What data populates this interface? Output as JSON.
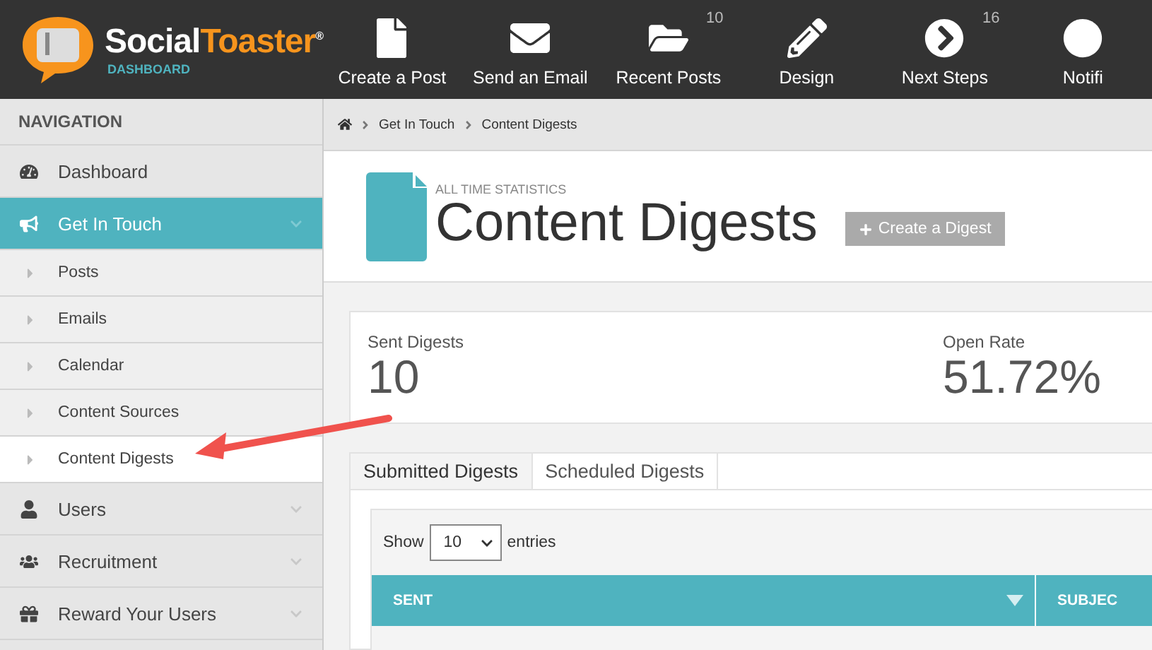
{
  "logo": {
    "brand_first": "Social",
    "brand_second": "Toaster",
    "registered": "®",
    "subtitle": "DASHBOARD"
  },
  "top_nav": [
    {
      "label": "Create a Post",
      "kind": "file"
    },
    {
      "label": "Send an Email",
      "kind": "envelope"
    },
    {
      "label": "Recent Posts",
      "kind": "folder",
      "badge": "10"
    },
    {
      "label": "Design",
      "kind": "pencil"
    },
    {
      "label": "Next Steps",
      "kind": "next",
      "badge": "16"
    },
    {
      "label": "Notifi",
      "kind": "circle"
    }
  ],
  "sidebar": {
    "heading": "NAVIGATION",
    "items": [
      {
        "label": "Dashboard",
        "kind": "gauge",
        "selected": false,
        "expandable": false
      },
      {
        "label": "Get In Touch",
        "kind": "megaphone",
        "selected": true,
        "expandable": true,
        "children": [
          {
            "label": "Posts",
            "selected": false
          },
          {
            "label": "Emails",
            "selected": false
          },
          {
            "label": "Calendar",
            "selected": false
          },
          {
            "label": "Content Sources",
            "selected": false
          },
          {
            "label": "Content Digests",
            "selected": true
          }
        ]
      },
      {
        "label": "Users",
        "kind": "user",
        "selected": false,
        "expandable": true
      },
      {
        "label": "Recruitment",
        "kind": "users",
        "selected": false,
        "expandable": true
      },
      {
        "label": "Reward Your Users",
        "kind": "gift",
        "selected": false,
        "expandable": true
      }
    ]
  },
  "breadcrumb": [
    "Get In Touch",
    "Content Digests"
  ],
  "header": {
    "eyebrow": "ALL TIME STATISTICS",
    "title": "Content Digests",
    "button": "Create a Digest"
  },
  "stats": [
    {
      "label": "Sent Digests",
      "value": "10"
    },
    {
      "label": "Open Rate",
      "value": "51.72%"
    }
  ],
  "tabs": [
    {
      "label": "Submitted Digests",
      "selected": true
    },
    {
      "label": "Scheduled Digests",
      "selected": false
    }
  ],
  "table": {
    "length_menu": {
      "before": "Show",
      "value": "10",
      "after": "entries"
    },
    "columns": [
      {
        "label": "SENT",
        "sorted": true
      },
      {
        "label": "SUBJEC",
        "sorted": false
      }
    ]
  }
}
